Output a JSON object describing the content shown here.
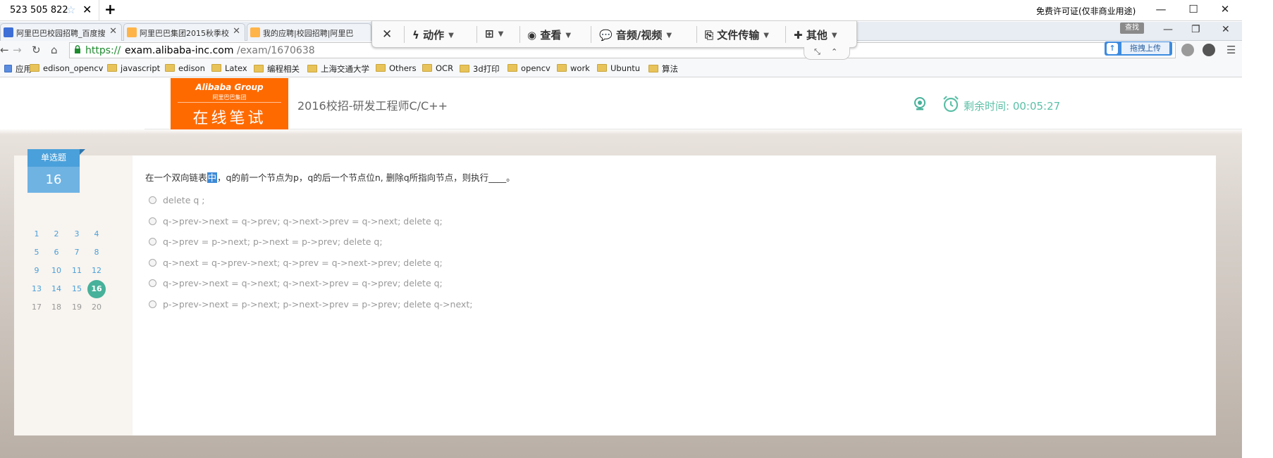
{
  "remote": {
    "partner_id": "523 505 822",
    "license_text": "免费许可证(仅非商业用途)",
    "toolbar": {
      "close_icon": "close-icon",
      "actions": "动作",
      "view": "查看",
      "audio_video": "音频/视频",
      "file_transfer": "文件传输",
      "other": "其他"
    },
    "mini_label": "查找",
    "drag_upload": "拖拽上传"
  },
  "browser": {
    "tabs": [
      {
        "title": "阿里巴巴校园招聘_百度搜",
        "icon_color": "#3e6fd6"
      },
      {
        "title": "阿里巴巴集团2015秋季校",
        "icon_color": "#ff8a00"
      },
      {
        "title": "我的应聘|校园招聘|阿里巴",
        "icon_color": "#ff8a00"
      }
    ],
    "url_scheme": "https://",
    "url_host": "exam.alibaba-inc.com",
    "url_path": "/exam/1670638",
    "bookmarks": [
      "应用",
      "edison_opencv",
      "javascript",
      "edison",
      "Latex",
      "编程相关",
      "上海交通大学",
      "Others",
      "OCR",
      "3d打印",
      "opencv",
      "work",
      "Ubuntu",
      "算法"
    ]
  },
  "exam": {
    "logo_top": "Alibaba Group",
    "logo_mid": "阿里巴巴集团",
    "logo_bottom": "在线笔试",
    "title": "2016校招-研发工程师C/C++",
    "timer": "剩余时间: 00:05:27",
    "question_type": "单选题",
    "current_number": "16",
    "numbers": [
      "1",
      "2",
      "3",
      "4",
      "5",
      "6",
      "7",
      "8",
      "9",
      "10",
      "11",
      "12",
      "13",
      "14",
      "15",
      "16",
      "17",
      "18",
      "19",
      "20"
    ],
    "question_pre": "在一个双向链表",
    "question_hl": "中",
    "question_post": "，q的前一个节点为p，q的后一个节点位n, 删除q所指向节点，则执行____。",
    "options": [
      "delete q ;",
      "q->prev->next = q->prev; q->next->prev = q->next; delete q;",
      "q->prev = p->next; p->next = p->prev; delete q;",
      "q->next = q->prev->next; q->prev = q->next->prev; delete q;",
      "q->prev->next = q->next; q->next->prev = q->prev; delete q;",
      "p->prev->next = p->next; p->next->prev = p->prev; delete q->next;"
    ]
  },
  "colors": {
    "brand_orange": "#ff6a00",
    "accent_teal": "#47b19a",
    "accent_blue": "#4aa0da"
  }
}
